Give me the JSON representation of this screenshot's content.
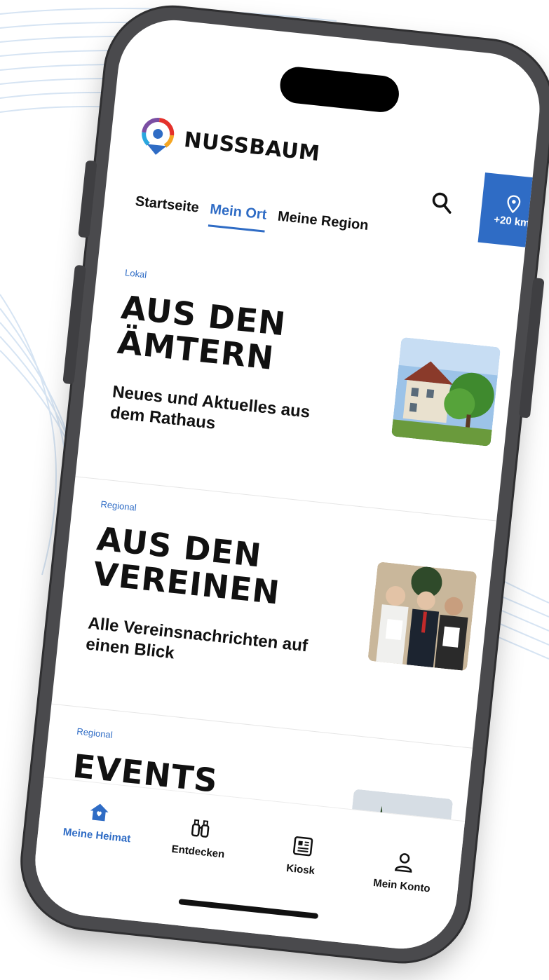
{
  "app": {
    "brand": "NUSSBAUM",
    "location_radius": "+20 km"
  },
  "tabs": [
    {
      "label": "Startseite",
      "active": false
    },
    {
      "label": "Mein Ort",
      "active": true
    },
    {
      "label": "Meine Region",
      "active": false
    }
  ],
  "cards": [
    {
      "tag": "Lokal",
      "title": "AUS DEN ÄMTERN",
      "subtitle": "Neues und Aktuelles aus dem Rathaus"
    },
    {
      "tag": "Regional",
      "title": "AUS DEN VEREINEN",
      "subtitle": "Alle Vereinsnachrichten auf einen Blick"
    },
    {
      "tag": "Regional",
      "title": "EVENTS",
      "subtitle": ""
    }
  ],
  "bottom_nav": [
    {
      "label": "Meine Heimat",
      "icon": "home-icon",
      "active": true
    },
    {
      "label": "Entdecken",
      "icon": "binoculars-icon",
      "active": false
    },
    {
      "label": "Kiosk",
      "icon": "newspaper-icon",
      "active": false
    },
    {
      "label": "Mein Konto",
      "icon": "user-icon",
      "active": false
    }
  ],
  "colors": {
    "accent": "#2f6cc5",
    "text": "#111111",
    "frame": "#4a4a4d"
  }
}
